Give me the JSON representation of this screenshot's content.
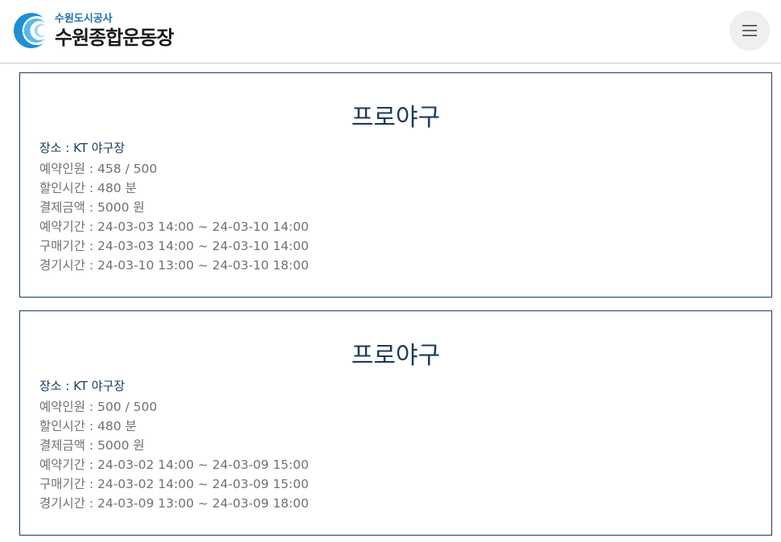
{
  "header": {
    "logo_sub": "수원도시공사",
    "logo_main": "수원종합운동장",
    "menu_icon": "hamburger-icon",
    "brand_color": "#1f6fb3"
  },
  "cards": [
    {
      "title": "프로야구",
      "location": "장소 : KT 야구장",
      "details": [
        "예약인원 : 458 / 500",
        "할인시간 : 480 분",
        "결제금액 : 5000 원",
        "예약기간 : 24-03-03 14:00 ~ 24-03-10 14:00",
        "구매기간 : 24-03-03 14:00 ~ 24-03-10 14:00",
        "경기시간 : 24-03-10 13:00 ~ 24-03-10 18:00"
      ]
    },
    {
      "title": "프로야구",
      "location": "장소 : KT 야구장",
      "details": [
        "예약인원 : 500 / 500",
        "할인시간 : 480 분",
        "결제금액 : 5000 원",
        "예약기간 : 24-03-02 14:00 ~ 24-03-09 15:00",
        "구매기간 : 24-03-02 14:00 ~ 24-03-09 15:00",
        "경기시간 : 24-03-09 13:00 ~ 24-03-09 18:00"
      ]
    }
  ]
}
